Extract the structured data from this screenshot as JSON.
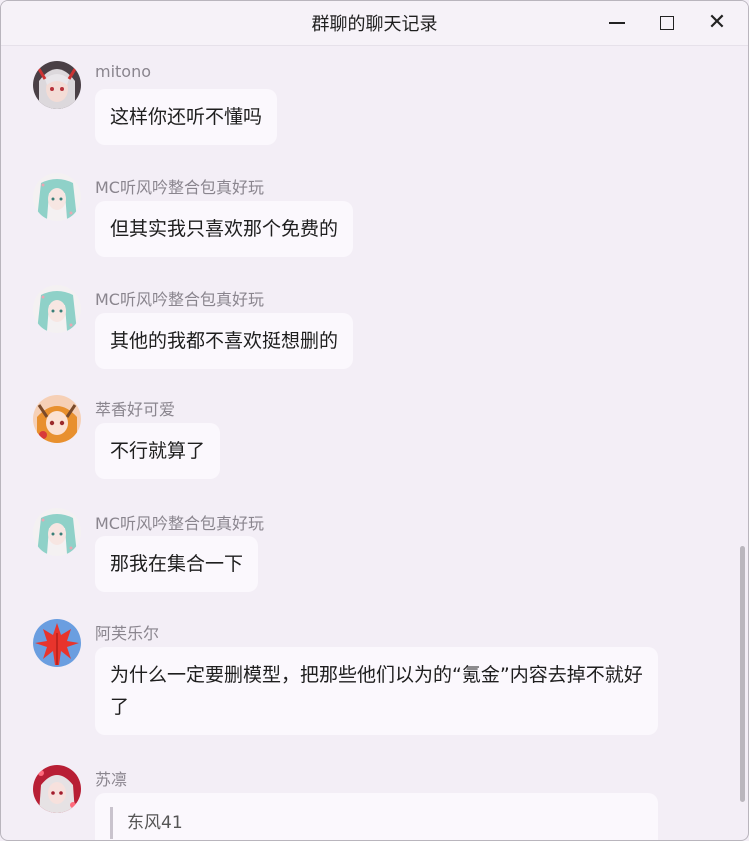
{
  "window": {
    "title": "群聊的聊天记录"
  },
  "messages": [
    {
      "sender": "mitono",
      "text": "这样你还听不懂吗",
      "avatar": "avatar-silver-hair"
    },
    {
      "sender": "MC听风吟整合包真好玩",
      "text": "但其实我只喜欢那个免费的",
      "avatar": "avatar-teal-hair"
    },
    {
      "sender": "MC听风吟整合包真好玩",
      "text": "其他的我都不喜欢挺想删的",
      "avatar": "avatar-teal-hair"
    },
    {
      "sender": "萃香好可爱",
      "text": "不行就算了",
      "avatar": "avatar-orange-hair"
    },
    {
      "sender": "MC听风吟整合包真好玩",
      "text": "那我在集合一下",
      "avatar": "avatar-teal-hair"
    },
    {
      "sender": "阿芙乐尔",
      "text": "为什么一定要删模型，把那些他们以为的“氪金”内容去掉不就好了",
      "avatar": "avatar-maple-leaf"
    },
    {
      "sender": "苏凛",
      "quote": "东风41",
      "avatar": "avatar-red-silver"
    }
  ],
  "colors": {
    "background": "#f3eef6",
    "bubble": "#fbf8fd",
    "sender_text": "#8a858e"
  }
}
